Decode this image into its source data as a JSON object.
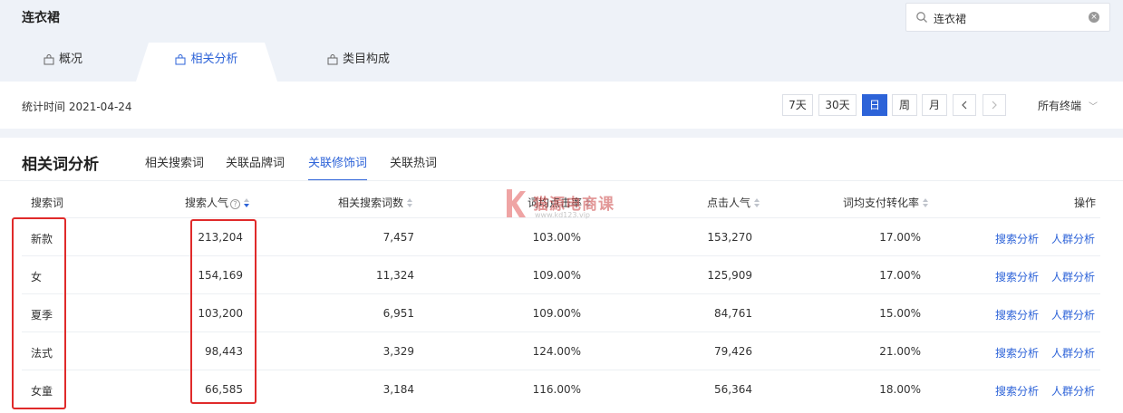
{
  "page_title": "连衣裙",
  "search": {
    "value": "连衣裙"
  },
  "tabs": [
    {
      "label": "概况"
    },
    {
      "label": "相关分析"
    },
    {
      "label": "类目构成"
    }
  ],
  "datebar": {
    "label": "统计时间 2021-04-24",
    "periods": [
      "7天",
      "30天",
      "日",
      "周",
      "月"
    ],
    "active_period": "日",
    "terminal": "所有终端"
  },
  "panel": {
    "title": "相关词分析",
    "subtabs": [
      "相关搜索词",
      "关联品牌词",
      "关联修饰词",
      "关联热词"
    ],
    "active_subtab": "关联修饰词"
  },
  "table": {
    "headers": [
      "搜索词",
      "搜索人气",
      "相关搜索词数",
      "词均点击率",
      "点击人气",
      "词均支付转化率",
      "操作"
    ],
    "rows": [
      {
        "word": "新款",
        "popularity": "213,204",
        "related": "7,457",
        "ctr": "103.00%",
        "clicks": "153,270",
        "cvr": "17.00%"
      },
      {
        "word": "女",
        "popularity": "154,169",
        "related": "11,324",
        "ctr": "109.00%",
        "clicks": "125,909",
        "cvr": "17.00%"
      },
      {
        "word": "夏季",
        "popularity": "103,200",
        "related": "6,951",
        "ctr": "109.00%",
        "clicks": "84,761",
        "cvr": "15.00%"
      },
      {
        "word": "法式",
        "popularity": "98,443",
        "related": "3,329",
        "ctr": "124.00%",
        "clicks": "79,426",
        "cvr": "21.00%"
      },
      {
        "word": "女童",
        "popularity": "66,585",
        "related": "3,184",
        "ctr": "116.00%",
        "clicks": "56,364",
        "cvr": "18.00%"
      }
    ],
    "actions": [
      "搜索分析",
      "人群分析"
    ]
  },
  "watermark": {
    "text": "猫源电商课",
    "sub": "www.kd123.vip"
  },
  "colors": {
    "accent": "#2d63d8",
    "highlight_box": "#e02a2a"
  },
  "icons": {
    "tab_icon": "bag-icon",
    "search": "search-icon",
    "clear": "clear-icon"
  }
}
